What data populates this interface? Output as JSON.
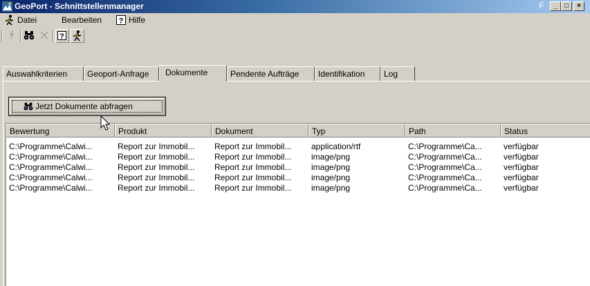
{
  "window": {
    "title": "GeoPort - Schnittstellenmanager",
    "titlebar_colors": {
      "start": "#0a246a",
      "end": "#a6caf0"
    },
    "controls": {
      "pin": "F",
      "minimize": "_",
      "maximize": "□",
      "close": "×"
    }
  },
  "menu": [
    {
      "label": "Datei",
      "icon": "running-man-icon"
    },
    {
      "label": "Bearbeiten"
    },
    {
      "label": "Hilfe",
      "icon": "help-icon"
    }
  ],
  "toolbar": [
    {
      "name": "lightning-icon"
    },
    {
      "name": "binoculars-icon"
    },
    {
      "name": "delete-x-icon"
    },
    {
      "name": "help-icon"
    },
    {
      "name": "running-man-icon"
    }
  ],
  "tabs": [
    "Auswahlkriterien",
    "Geoport-Anfrage",
    "Dokumente",
    "Pendente Aufträge",
    "Identifikation",
    "Log"
  ],
  "active_tab": "Dokumente",
  "query_button": {
    "label": "Jetzt Dokumente abfragen",
    "icon": "binoculars-icon"
  },
  "table": {
    "columns": [
      "Bewertung",
      "Produkt",
      "Dokument",
      "Typ",
      "Path",
      "Status"
    ],
    "rows": [
      [
        "C:\\Programme\\Calwi...",
        "Report zur Immobil...",
        "Report zur Immobil...",
        "application/rtf",
        "C:\\Programme\\Ca...",
        "verfügbar"
      ],
      [
        "C:\\Programme\\Calwi...",
        "Report zur Immobil...",
        "Report zur Immobil...",
        "image/png",
        "C:\\Programme\\Ca...",
        "verfügbar"
      ],
      [
        "C:\\Programme\\Calwi...",
        "Report zur Immobil...",
        "Report zur Immobil...",
        "image/png",
        "C:\\Programme\\Ca...",
        "verfügbar"
      ],
      [
        "C:\\Programme\\Calwi...",
        "Report zur Immobil...",
        "Report zur Immobil...",
        "image/png",
        "C:\\Programme\\Ca...",
        "verfügbar"
      ],
      [
        "C:\\Programme\\Calwi...",
        "Report zur Immobil...",
        "Report zur Immobil...",
        "image/png",
        "C:\\Programme\\Ca...",
        "verfügbar"
      ]
    ]
  }
}
